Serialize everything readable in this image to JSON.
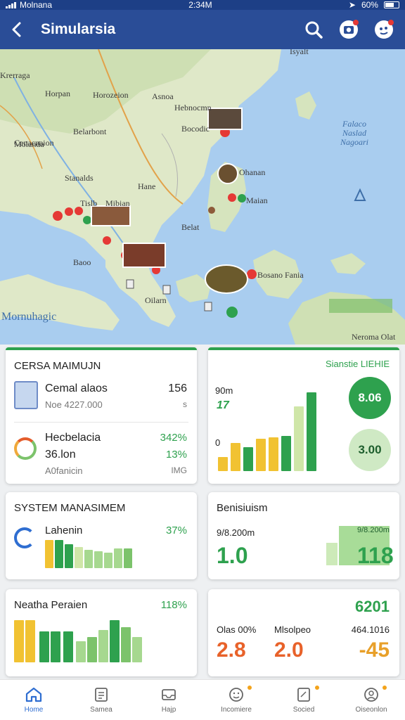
{
  "status_bar": {
    "carrier": "Molnana",
    "time": "2:34M",
    "battery": "60%"
  },
  "app_bar": {
    "title": "Simularsia",
    "icons": [
      "back-arrow-icon",
      "search-icon",
      "camera-icon",
      "chat-icon"
    ]
  },
  "map": {
    "labels": {
      "top_right": "Isyalt",
      "upper_left_1": "Krerraga",
      "left_1": "Horpan",
      "left_2": "Molanda",
      "center_1": "Horozeion",
      "center_2": "Asnoa",
      "center_3": "Hebnocmn",
      "left_3": "Belarbont",
      "center_4": "Bocodic",
      "left_4": "Cenacnaion",
      "left_5": "Stanalds",
      "center_5": "Hane",
      "right_1": "Ohanan",
      "right_2": "Maian",
      "left_6": "Tislb",
      "center_6": "Mibian",
      "center_7": "Belat",
      "left_7": "Baoo",
      "right_3": "Bosano Fania",
      "center_8": "Oilarn",
      "bottom_left": "Mornuhagic",
      "bottom_right": "Neroma Olat",
      "sea": "Falaco Naslad Nagoari"
    }
  },
  "cards": {
    "card1": {
      "title": "CERSA MAIMUJN",
      "row1": {
        "label": "Cemal alaos",
        "sub": "Noe 4227.000",
        "value": "156",
        "value_sub": "s"
      },
      "row2": {
        "label": "Hecbelacia",
        "label2": "36.lon",
        "sub": "A0fanicin",
        "value": "342%",
        "value2": "13%",
        "value_sub": "IMG"
      }
    },
    "card2": {
      "title": "Sianstie LIEHIE",
      "axis_top": "90m",
      "axis_bottom": "0",
      "mark": "17",
      "badge1": "8.06",
      "badge2": "3.00"
    },
    "card3": {
      "title": "SYSTEM MANASIMEM",
      "label": "Lahenin",
      "value": "37%"
    },
    "card4": {
      "title": "Benisiuism",
      "sub": "9/8.200m",
      "value_left": "1.0",
      "bar_label": "9/8.200m",
      "value_right": "118"
    },
    "card5": {
      "title": "Neatha Peraien",
      "value": "118%"
    },
    "card6": {
      "top_value": "6201",
      "col1_label": "Olas 00%",
      "col1_value": "2.8",
      "col2_label": "Mlsolpeo",
      "col2_value": "2.0",
      "col3_label": "464.1016",
      "col3_value": "-45"
    }
  },
  "bottom_nav": [
    {
      "label": "Home",
      "icon": "home-icon"
    },
    {
      "label": "Samea",
      "icon": "document-icon"
    },
    {
      "label": "Hajp",
      "icon": "inbox-icon"
    },
    {
      "label": "Incomiere",
      "icon": "face-icon"
    },
    {
      "label": "Socied",
      "icon": "tablet-icon"
    },
    {
      "label": "Oiseonlon",
      "icon": "profile-icon"
    }
  ],
  "colors": {
    "primary": "#2a4d97",
    "green": "#2ea14e",
    "yellow": "#f1c232",
    "light_green": "#bfe3a4",
    "orange": "#e8622a",
    "active": "#2f6ed1"
  }
}
